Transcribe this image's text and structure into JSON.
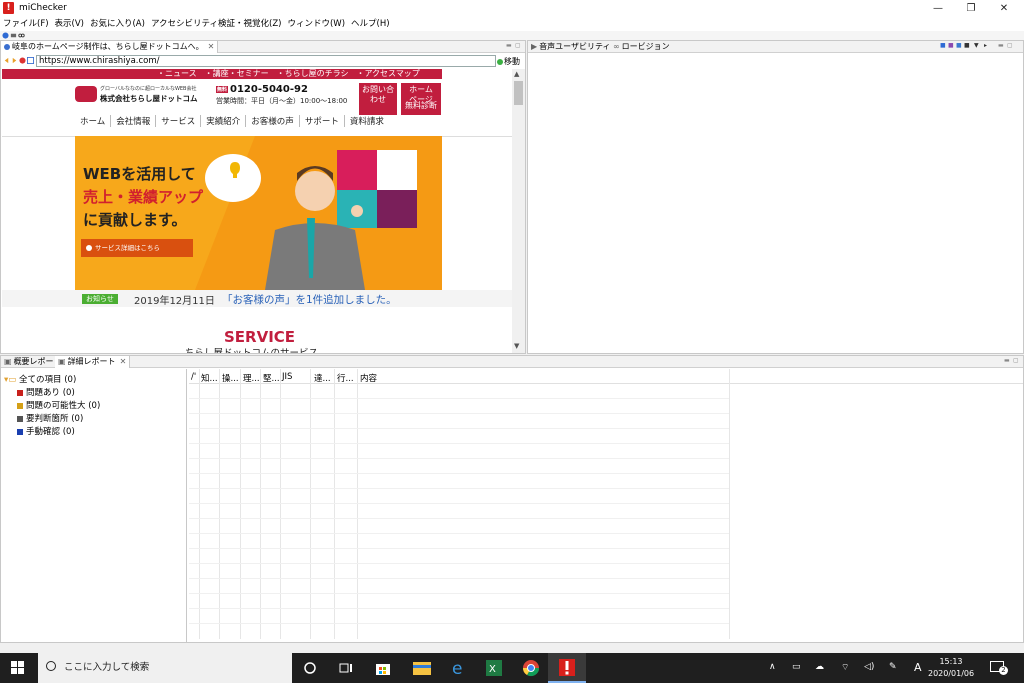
{
  "window": {
    "title": "miChecker",
    "logo_glyph": "!",
    "controls": {
      "minimize": "—",
      "restore": "❐",
      "close": "✕"
    }
  },
  "menu": [
    "ファイル(F)",
    "表示(V)",
    "お気に入り(A)",
    "アクセシビリティ検証・視覚化(Z)",
    "ウィンドウ(W)",
    "ヘルプ(H)"
  ],
  "browser": {
    "tab_label": "岐阜のホームページ制作は、ちらし屋ドットコムへ。",
    "url": "https://www.chirashiya.com/",
    "go_label": "移動",
    "site": {
      "top_nav": [
        "・ニュース",
        "・講座・セミナー",
        "・ちらし屋のチラシ",
        "・アクセスマップ"
      ],
      "tagline": "グローバルななのに超ローカルなWEB会社",
      "company": "株式会社ちらし屋ドットコム",
      "free_badge": "無料",
      "phone": "0120-5040-92",
      "hours": "営業時間：平日（月〜金）10:00〜18:00",
      "contact_btn": [
        "お問い合",
        "わせ"
      ],
      "diagnosis_btn": [
        "ホーム",
        "ページ",
        "無料診断"
      ],
      "global_nav": [
        "ホーム",
        "会社情報",
        "サービス",
        "実績紹介",
        "お客様の声",
        "サポート",
        "資料請求"
      ],
      "hero_lines": [
        "WEBを活用して",
        "売上・業績アップ",
        "に貢献します。"
      ],
      "hero_button": "サービス詳細はこちら",
      "news_badge": "お知らせ",
      "news_date": "2019年12月11日",
      "news_text": "「お客様の声」を1件追加しました。",
      "service_title": "SERVICE",
      "service_sub": "ちらし屋ドットコムのサービス"
    }
  },
  "right_pane": {
    "tabs": [
      "音声ユーザビリティ",
      "ロービジョン"
    ]
  },
  "report": {
    "tabs": [
      "概要レポート",
      "詳細レポート"
    ],
    "tree": [
      {
        "label": "全ての項目",
        "count": "(0)",
        "color": ""
      },
      {
        "label": "問題あり",
        "count": "(0)",
        "color": "#c8201c"
      },
      {
        "label": "問題の可能性大",
        "count": "(0)",
        "color": "#d4a017"
      },
      {
        "label": "要判断箇所",
        "count": "(0)",
        "color": "#555555"
      },
      {
        "label": "手動確認",
        "count": "(0)",
        "color": "#1a3fb0"
      }
    ],
    "columns": [
      "",
      "知...",
      "操...",
      "理...",
      "堅...",
      "JIS",
      "達...",
      "行...",
      "内容"
    ]
  },
  "taskbar": {
    "search_placeholder": "ここに入力して検索",
    "time": "15:13",
    "date": "2020/01/06",
    "ime": "A",
    "notif_count": "2"
  }
}
